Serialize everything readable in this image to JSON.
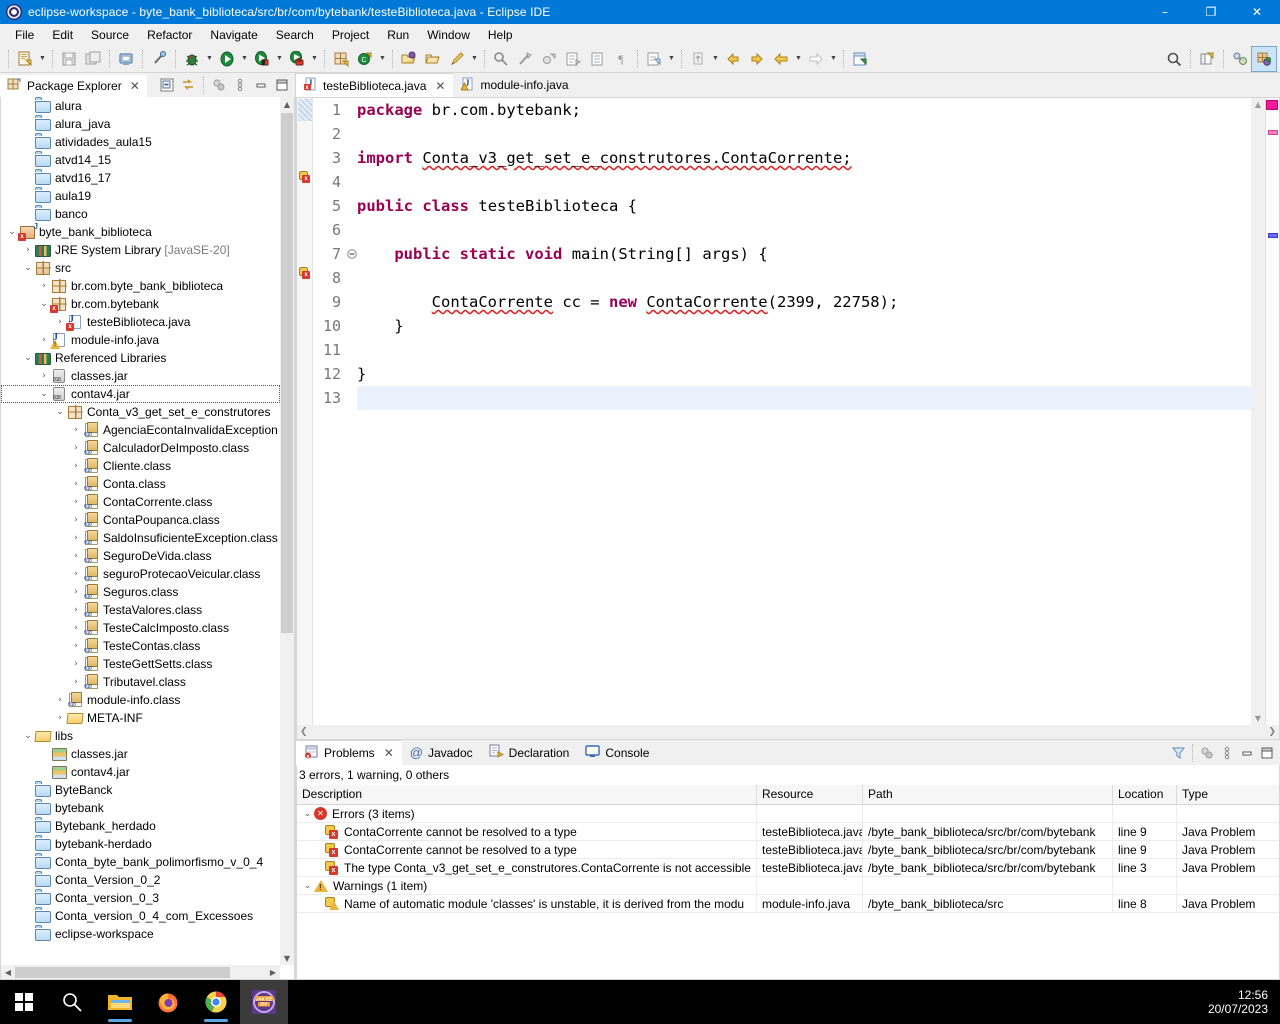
{
  "window": {
    "title": "eclipse-workspace - byte_bank_biblioteca/src/br/com/bytebank/testeBiblioteca.java - Eclipse IDE",
    "minimize": "–",
    "maximize": "❐",
    "close": "✕"
  },
  "menubar": {
    "items": [
      "File",
      "Edit",
      "Source",
      "Refactor",
      "Navigate",
      "Search",
      "Project",
      "Run",
      "Window",
      "Help"
    ]
  },
  "explorer": {
    "tab_label": "Package Explorer",
    "close_label": "✕",
    "tools": [
      "collapse-all-icon",
      "link-with-editor-icon",
      "view-menu-icon",
      "minimize-icon",
      "maximize-icon"
    ],
    "tree": [
      {
        "label": "alura",
        "icon": "folder-icon",
        "indent": 1,
        "twisty": ""
      },
      {
        "label": "alura_java",
        "icon": "folder-icon",
        "indent": 1,
        "twisty": ""
      },
      {
        "label": "atividades_aula15",
        "icon": "folder-icon",
        "indent": 1,
        "twisty": ""
      },
      {
        "label": "atvd14_15",
        "icon": "folder-icon",
        "indent": 1,
        "twisty": ""
      },
      {
        "label": "atvd16_17",
        "icon": "folder-icon",
        "indent": 1,
        "twisty": ""
      },
      {
        "label": "aula19",
        "icon": "folder-icon",
        "indent": 1,
        "twisty": ""
      },
      {
        "label": "banco",
        "icon": "folder-icon",
        "indent": 1,
        "twisty": ""
      },
      {
        "label": "byte_bank_biblioteca",
        "icon": "java-project-icon",
        "indent": 0,
        "twisty": "open",
        "badge": "error"
      },
      {
        "label": "JRE System Library",
        "suffix": " [JavaSE-20]",
        "icon": "library-icon",
        "indent": 1,
        "twisty": "closed"
      },
      {
        "label": "src",
        "icon": "source-folder-icon",
        "indent": 1,
        "twisty": "open"
      },
      {
        "label": "br.com.byte_bank_biblioteca",
        "icon": "package-icon",
        "indent": 2,
        "twisty": "closed"
      },
      {
        "label": "br.com.bytebank",
        "icon": "package-icon",
        "indent": 2,
        "twisty": "open",
        "badge": "error"
      },
      {
        "label": "testeBiblioteca.java",
        "icon": "java-file-icon",
        "indent": 3,
        "twisty": "closed",
        "badge": "error"
      },
      {
        "label": "module-info.java",
        "icon": "java-file-icon",
        "indent": 2,
        "twisty": "closed",
        "badge": "warning"
      },
      {
        "label": "Referenced Libraries",
        "icon": "library-icon",
        "indent": 1,
        "twisty": "open"
      },
      {
        "label": "classes.jar",
        "icon": "jar-icon",
        "indent": 2,
        "twisty": "closed"
      },
      {
        "label": "contav4.jar",
        "icon": "jar-icon",
        "indent": 2,
        "twisty": "open",
        "selected": true
      },
      {
        "label": "Conta_v3_get_set_e_construtores",
        "icon": "package-icon",
        "indent": 3,
        "twisty": "open"
      },
      {
        "label": "AgenciaEcontaInvalidaException",
        "icon": "class-icon",
        "indent": 4,
        "twisty": "closed"
      },
      {
        "label": "CalculadorDeImposto.class",
        "icon": "class-icon",
        "indent": 4,
        "twisty": "closed"
      },
      {
        "label": "Cliente.class",
        "icon": "class-icon",
        "indent": 4,
        "twisty": "closed"
      },
      {
        "label": "Conta.class",
        "icon": "abstract-class-icon",
        "indent": 4,
        "twisty": "closed"
      },
      {
        "label": "ContaCorrente.class",
        "icon": "class-icon",
        "indent": 4,
        "twisty": "closed"
      },
      {
        "label": "ContaPoupanca.class",
        "icon": "class-icon",
        "indent": 4,
        "twisty": "closed"
      },
      {
        "label": "SaldoInsuficienteException.class",
        "icon": "class-icon",
        "indent": 4,
        "twisty": "closed"
      },
      {
        "label": "SeguroDeVida.class",
        "icon": "class-icon",
        "indent": 4,
        "twisty": "closed"
      },
      {
        "label": "seguroProtecaoVeicular.class",
        "icon": "class-icon",
        "indent": 4,
        "twisty": "closed"
      },
      {
        "label": "Seguros.class",
        "icon": "class-icon",
        "indent": 4,
        "twisty": "closed"
      },
      {
        "label": "TestaValores.class",
        "icon": "class-icon",
        "indent": 4,
        "twisty": "closed"
      },
      {
        "label": "TesteCalcImposto.class",
        "icon": "class-icon",
        "indent": 4,
        "twisty": "closed"
      },
      {
        "label": "TesteContas.class",
        "icon": "class-icon",
        "indent": 4,
        "twisty": "closed"
      },
      {
        "label": "TesteGettSetts.class",
        "icon": "class-icon",
        "indent": 4,
        "twisty": "closed"
      },
      {
        "label": "Tributavel.class",
        "icon": "interface-icon",
        "indent": 4,
        "twisty": "closed"
      },
      {
        "label": "module-info.class",
        "icon": "class-icon",
        "indent": 3,
        "twisty": "closed"
      },
      {
        "label": "META-INF",
        "icon": "folder-open-icon",
        "indent": 3,
        "twisty": "closed"
      },
      {
        "label": "libs",
        "icon": "folder-open-icon",
        "indent": 1,
        "twisty": "open"
      },
      {
        "label": "classes.jar",
        "icon": "jar-java-icon",
        "indent": 2,
        "twisty": ""
      },
      {
        "label": "contav4.jar",
        "icon": "jar-java-icon",
        "indent": 2,
        "twisty": ""
      },
      {
        "label": "ByteBanck",
        "icon": "folder-icon",
        "indent": 1,
        "twisty": ""
      },
      {
        "label": "bytebank",
        "icon": "folder-icon",
        "indent": 1,
        "twisty": ""
      },
      {
        "label": "Bytebank_herdado",
        "icon": "folder-icon",
        "indent": 1,
        "twisty": ""
      },
      {
        "label": "bytebank-herdado",
        "icon": "folder-icon",
        "indent": 1,
        "twisty": ""
      },
      {
        "label": "Conta_byte_bank_polimorfismo_v_0_4",
        "icon": "folder-icon",
        "indent": 1,
        "twisty": ""
      },
      {
        "label": "Conta_Version_0_2",
        "icon": "folder-icon",
        "indent": 1,
        "twisty": ""
      },
      {
        "label": "Conta_version_0_3",
        "icon": "folder-icon",
        "indent": 1,
        "twisty": ""
      },
      {
        "label": "Conta_version_0_4_com_Excessoes",
        "icon": "folder-icon",
        "indent": 1,
        "twisty": ""
      },
      {
        "label": "eclipse-workspace",
        "icon": "folder-icon",
        "indent": 1,
        "twisty": ""
      }
    ]
  },
  "editor": {
    "tabs": [
      {
        "label": "testeBiblioteca.java",
        "active": true,
        "icon": "java-file-error-icon",
        "closable": true
      },
      {
        "label": "module-info.java",
        "active": false,
        "icon": "java-file-warning-icon",
        "closable": false
      }
    ],
    "lines": [
      {
        "n": "1",
        "marker": "",
        "fold": false
      },
      {
        "n": "2",
        "marker": "",
        "fold": false
      },
      {
        "n": "3",
        "marker": "error",
        "fold": false
      },
      {
        "n": "4",
        "marker": "",
        "fold": false
      },
      {
        "n": "5",
        "marker": "",
        "fold": false
      },
      {
        "n": "6",
        "marker": "",
        "fold": false
      },
      {
        "n": "7",
        "marker": "",
        "fold": true
      },
      {
        "n": "8",
        "marker": "",
        "fold": false
      },
      {
        "n": "9",
        "marker": "error",
        "fold": false
      },
      {
        "n": "10",
        "marker": "",
        "fold": false
      },
      {
        "n": "11",
        "marker": "",
        "fold": false
      },
      {
        "n": "12",
        "marker": "",
        "fold": false
      },
      {
        "n": "13",
        "marker": "",
        "fold": false,
        "current": true
      }
    ],
    "code": {
      "l1_kw": "package",
      "l1_rest": " br.com.bytebank;",
      "l3_kw": "import",
      "l3_rest": "Conta_v3_get_set_e_construtores.ContaCorrente;",
      "l5_kw1": "public",
      "l5_kw2": "class",
      "l5_rest": "testeBiblioteca {",
      "l7_kw1": "public",
      "l7_kw2": "static",
      "l7_kw3": "void",
      "l7_rest": "main(String[] args) {",
      "l9_type": "ContaCorrente",
      "l9_var": " cc = ",
      "l9_kw": "new",
      "l9_call": "ContaCorrente",
      "l9_args": "(2399, 22758);",
      "l10_brace": "}",
      "l12_brace": "}"
    }
  },
  "problems": {
    "tabs": [
      {
        "label": "Problems",
        "icon": "problems-icon",
        "active": true,
        "closable": true
      },
      {
        "label": "Javadoc",
        "icon": "javadoc-icon",
        "active": false,
        "closable": false
      },
      {
        "label": "Declaration",
        "icon": "declaration-icon",
        "active": false,
        "closable": false
      },
      {
        "label": "Console",
        "icon": "console-icon",
        "active": false,
        "closable": false
      }
    ],
    "summary": "3 errors, 1 warning, 0 others",
    "columns": [
      "Description",
      "Resource",
      "Path",
      "Location",
      "Type"
    ],
    "rows": [
      {
        "kind": "group-error",
        "twisty": "open",
        "description": "Errors (3 items)",
        "resource": "",
        "path": "",
        "location": "",
        "type": ""
      },
      {
        "kind": "error",
        "description": "ContaCorrente cannot be resolved to a type",
        "resource": "testeBiblioteca.java",
        "path": "/byte_bank_biblioteca/src/br/com/bytebank",
        "location": "line 9",
        "type": "Java Problem"
      },
      {
        "kind": "error",
        "description": "ContaCorrente cannot be resolved to a type",
        "resource": "testeBiblioteca.java",
        "path": "/byte_bank_biblioteca/src/br/com/bytebank",
        "location": "line 9",
        "type": "Java Problem"
      },
      {
        "kind": "error",
        "description": "The type Conta_v3_get_set_e_construtores.ContaCorrente is not accessible",
        "resource": "testeBiblioteca.java",
        "path": "/byte_bank_biblioteca/src/br/com/bytebank",
        "location": "line 3",
        "type": "Java Problem"
      },
      {
        "kind": "group-warning",
        "twisty": "open",
        "description": "Warnings (1 item)",
        "resource": "",
        "path": "",
        "location": "",
        "type": ""
      },
      {
        "kind": "warning",
        "description": "Name of automatic module 'classes' is unstable, it is derived from the modu",
        "resource": "module-info.java",
        "path": "/byte_bank_biblioteca/src",
        "location": "line 8",
        "type": "Java Problem"
      }
    ],
    "tools": [
      "filter-icon",
      "view-menu-icon",
      "minimize-icon",
      "maximize-icon"
    ]
  },
  "taskbar": {
    "items": [
      "start-icon",
      "search-icon",
      "file-explorer-icon",
      "firefox-icon",
      "chrome-icon",
      "eclipse-icon"
    ],
    "clock_time": "12:56",
    "clock_date": "20/07/2023"
  },
  "colors": {
    "titlebar": "#0078d7",
    "keyword": "#9c0052",
    "error": "#d8382c",
    "warning": "#eab33a",
    "current_line": "#eaf2fd"
  }
}
